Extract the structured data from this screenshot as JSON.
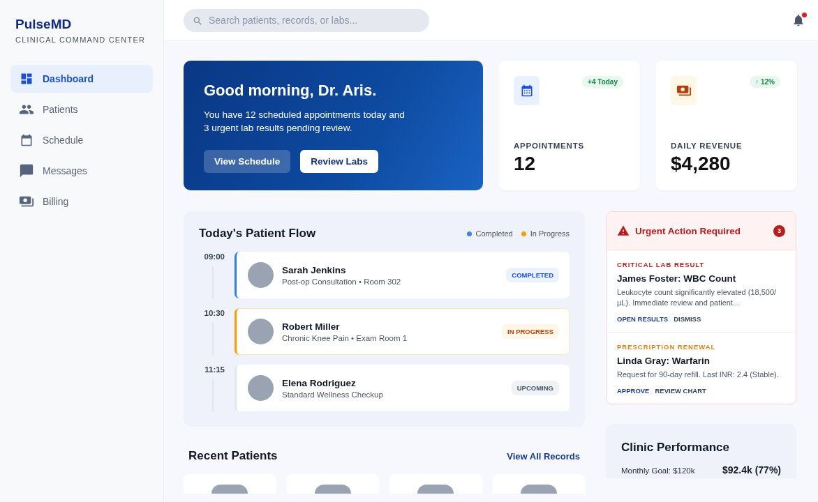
{
  "sidebar": {
    "brand": "PulseMD",
    "subtitle": "CLINICAL COMMAND CENTER",
    "items": [
      {
        "label": "Dashboard",
        "selected": true
      },
      {
        "label": "Patients",
        "selected": false
      },
      {
        "label": "Schedule",
        "selected": false
      },
      {
        "label": "Messages",
        "selected": false
      },
      {
        "label": "Billing",
        "selected": false
      }
    ]
  },
  "header": {
    "search": {
      "placeholder": "Search patients, records, or labs..."
    },
    "notifications": {
      "unread": true
    }
  },
  "hero": {
    "title": "Good morning, Dr. Aris.",
    "text": "You have 12 scheduled appointments today and 3 urgent lab results pending review.",
    "buttons": [
      {
        "label": "View Schedule",
        "kind": "secondary"
      },
      {
        "label": "Review Labs",
        "kind": "primary"
      }
    ]
  },
  "stats": [
    {
      "kind": "appointments",
      "badge": "+4 Today",
      "label": "APPOINTMENTS",
      "value": "12"
    },
    {
      "kind": "revenue",
      "badge": "↑ 12%",
      "label": "DAILY REVENUE",
      "value": "$4,280"
    }
  ],
  "patient_flow": {
    "title": "Today's Patient Flow",
    "legend": [
      {
        "label": "Completed",
        "color": "#3b82f6"
      },
      {
        "label": "In Progress",
        "color": "#f59e0b"
      }
    ],
    "items": [
      {
        "time": "09:00",
        "name": "Sarah Jenkins",
        "detail": "Post-op Consultation • Room 302",
        "status": "COMPLETED",
        "kind": "completed"
      },
      {
        "time": "10:30",
        "name": "Robert Miller",
        "detail": "Chronic Knee Pain • Exam Room 1",
        "status": "IN PROGRESS",
        "kind": "in_progress"
      },
      {
        "time": "11:15",
        "name": "Elena Rodriguez",
        "detail": "Standard Wellness Checkup",
        "status": "UPCOMING",
        "kind": "upcoming"
      }
    ]
  },
  "urgent": {
    "title": "Urgent Action Required",
    "count": "3",
    "items": [
      {
        "kind": "critical",
        "category": "CRITICAL LAB RESULT",
        "title": "James Foster: WBC Count",
        "text": "Leukocyte count significantly elevated (18,500/µL). Immediate review and patient...",
        "actions": [
          "OPEN RESULTS",
          "DISMISS"
        ]
      },
      {
        "kind": "renewal",
        "category": "PRESCRIPTION RENEWAL",
        "title": "Linda Gray: Warfarin",
        "text": "Request for 90-day refill. Last INR: 2.4 (Stable).",
        "actions": [
          "APPROVE",
          "REVIEW CHART"
        ]
      }
    ]
  },
  "recent_patients": {
    "title": "Recent Patients",
    "link": "View All Records",
    "cards": [
      {
        "kind": "patient"
      },
      {
        "kind": "patient"
      },
      {
        "kind": "patient"
      },
      {
        "kind": "patient"
      }
    ]
  },
  "clinic_performance": {
    "title": "Clinic Performance",
    "goal": "Monthly Goal: $120k",
    "value": "$92.4k (77%)"
  }
}
